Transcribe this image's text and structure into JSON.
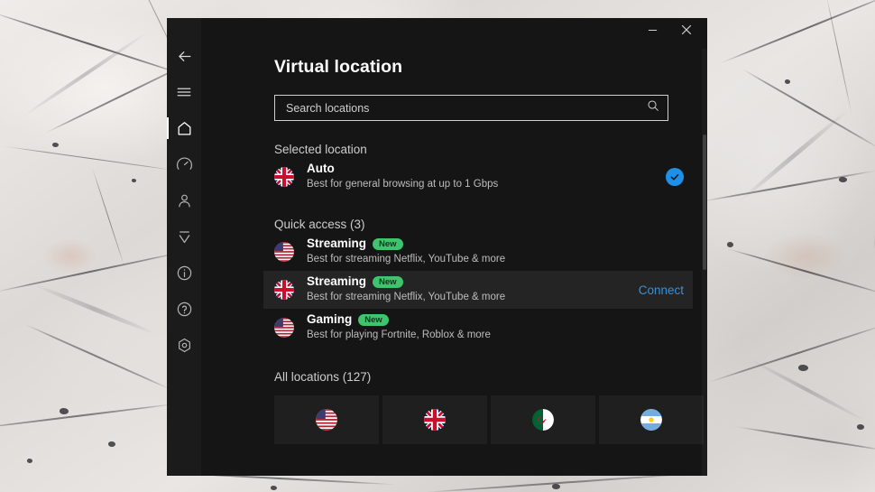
{
  "window": {
    "title": "Virtual location",
    "controls": {
      "minimize": "minimize",
      "close": "close"
    }
  },
  "sidebar": {
    "items": [
      {
        "name": "back",
        "icon": "back-arrow-icon",
        "active": false
      },
      {
        "name": "menu",
        "icon": "hamburger-icon",
        "active": false
      },
      {
        "name": "home",
        "icon": "home-icon",
        "active": true
      },
      {
        "name": "speed",
        "icon": "speedometer-icon",
        "active": false
      },
      {
        "name": "account",
        "icon": "person-icon",
        "active": false
      },
      {
        "name": "collapse",
        "icon": "chevron-up-bar-icon",
        "active": false
      },
      {
        "name": "info",
        "icon": "info-circle-icon",
        "active": false
      },
      {
        "name": "help",
        "icon": "question-circle-icon",
        "active": false
      },
      {
        "name": "settings",
        "icon": "gear-hex-icon",
        "active": false
      }
    ]
  },
  "search": {
    "placeholder": "Search locations",
    "value": "",
    "icon": "search-icon"
  },
  "selected_location": {
    "label": "Selected location",
    "item": {
      "flag": "uk-flag",
      "title": "Auto",
      "subtitle": "Best for general browsing at up to 1 Gbps",
      "selected": true,
      "check_icon": "check-circle-icon"
    }
  },
  "quick_access": {
    "label": "Quick access (3)",
    "items": [
      {
        "flag": "us-flag",
        "title": "Streaming",
        "badge": "New",
        "subtitle": "Best for streaming Netflix, YouTube & more",
        "highlighted": false,
        "action": ""
      },
      {
        "flag": "uk-flag",
        "title": "Streaming",
        "badge": "New",
        "subtitle": "Best for streaming Netflix, YouTube & more",
        "highlighted": true,
        "action": "Connect"
      },
      {
        "flag": "us-flag",
        "title": "Gaming",
        "badge": "New",
        "subtitle": "Best for playing Fortnite, Roblox & more",
        "highlighted": false,
        "action": ""
      }
    ]
  },
  "all_locations": {
    "label": "All locations (127)",
    "tiles": [
      {
        "flag": "us-flag"
      },
      {
        "flag": "uk-flag"
      },
      {
        "flag": "algeria-flag"
      },
      {
        "flag": "argentina-flag"
      }
    ]
  },
  "colors": {
    "window_bg": "#151515",
    "rail_bg": "#1b1b1b",
    "row_highlight": "#242424",
    "accent_blue": "#1e90e8",
    "link_blue": "#3c8fd6",
    "badge_green": "#3ec46d",
    "tile_bg": "#1f1f1f"
  }
}
